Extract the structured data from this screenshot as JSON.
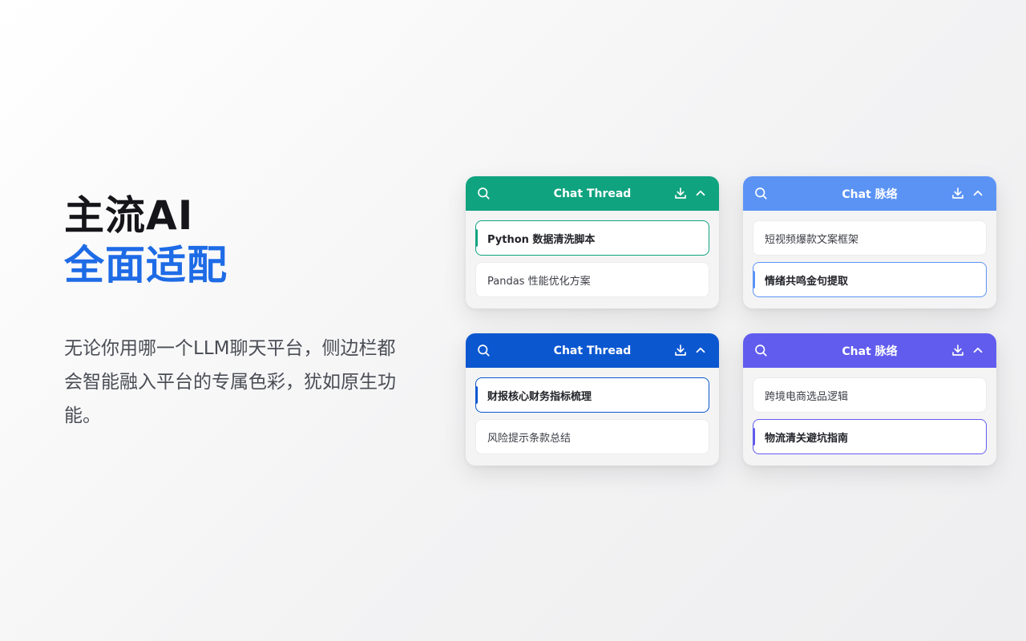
{
  "hero": {
    "title_line1": "主流AI",
    "title_line2": "全面适配",
    "description": "无论你用哪一个LLM聊天平台，侧边栏都会智能融入平台的专属色彩，犹如原生功能。"
  },
  "cards": [
    {
      "title": "Chat Thread",
      "accent": "#10a37f",
      "items": [
        "Python 数据清洗脚本",
        "Pandas 性能优化方案"
      ],
      "active_index": 0
    },
    {
      "title": "Chat 脉络",
      "accent": "#5b93f5",
      "items": [
        "短视频爆款文案框架",
        "情绪共鸣金句提取"
      ],
      "active_index": 1
    },
    {
      "title": "Chat Thread",
      "accent": "#0b57d0",
      "items": [
        "财报核心财务指标梳理",
        "风险提示条款总结"
      ],
      "active_index": 0
    },
    {
      "title": "Chat 脉络",
      "accent": "#615ced",
      "items": [
        "跨境电商选品逻辑",
        "物流清关避坑指南"
      ],
      "active_index": 1
    }
  ],
  "icons": {
    "search": "search-icon",
    "download": "download-icon",
    "collapse": "chevron-up-icon"
  }
}
